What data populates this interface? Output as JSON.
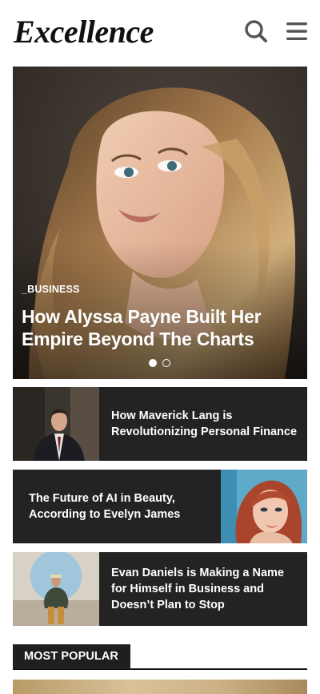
{
  "header": {
    "logo": "Excellence",
    "search_icon": "search-icon",
    "menu_icon": "hamburger-menu-icon"
  },
  "hero": {
    "category": "_BUSINESS",
    "title": "How Alyssa Payne Built Her Empire Beyond The Charts",
    "slides_total": 2,
    "active_slide": 1
  },
  "articles": [
    {
      "title": "How Maverick Lang is Revolutionizing Personal Finance",
      "image_side": "left"
    },
    {
      "title": "The Future of AI in Beauty, According to Evelyn James",
      "image_side": "right"
    },
    {
      "title": "Evan Daniels is Making a Name for Himself in Business and Doesn’t Plan to Stop",
      "image_side": "left"
    }
  ],
  "section": {
    "label": "MOST POPULAR"
  },
  "colors": {
    "card_bg": "#232323",
    "text_dark": "#111111",
    "icon": "#555555"
  }
}
